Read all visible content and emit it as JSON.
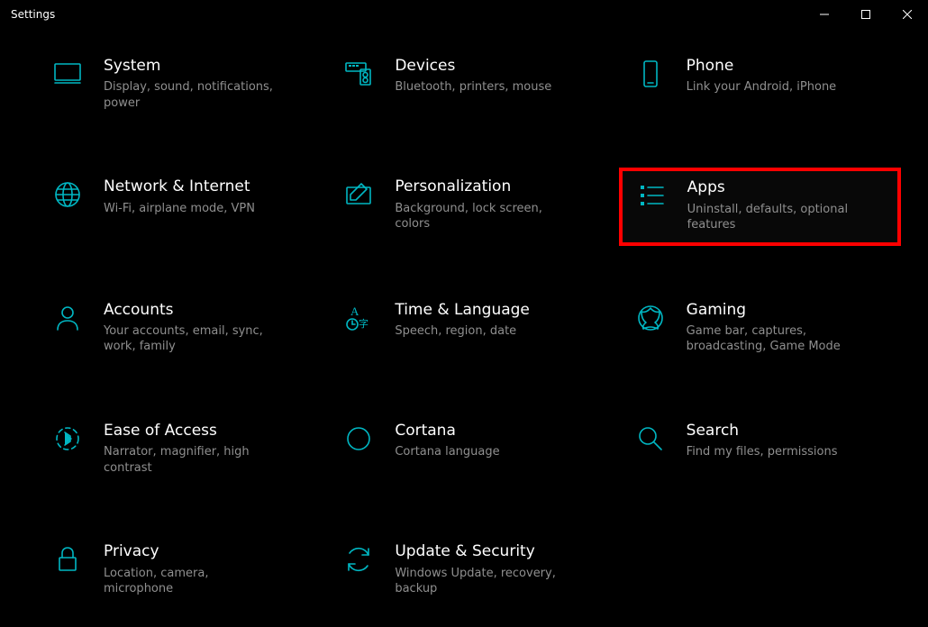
{
  "window": {
    "title": "Settings"
  },
  "accent": "#00b7c3",
  "categories": [
    {
      "id": "system",
      "title": "System",
      "desc": "Display, sound, notifications, power"
    },
    {
      "id": "devices",
      "title": "Devices",
      "desc": "Bluetooth, printers, mouse"
    },
    {
      "id": "phone",
      "title": "Phone",
      "desc": "Link your Android, iPhone"
    },
    {
      "id": "network",
      "title": "Network & Internet",
      "desc": "Wi-Fi, airplane mode, VPN"
    },
    {
      "id": "personalization",
      "title": "Personalization",
      "desc": "Background, lock screen, colors"
    },
    {
      "id": "apps",
      "title": "Apps",
      "desc": "Uninstall, defaults, optional features",
      "highlight": true
    },
    {
      "id": "accounts",
      "title": "Accounts",
      "desc": "Your accounts, email, sync, work, family"
    },
    {
      "id": "time",
      "title": "Time & Language",
      "desc": "Speech, region, date"
    },
    {
      "id": "gaming",
      "title": "Gaming",
      "desc": "Game bar, captures, broadcasting, Game Mode"
    },
    {
      "id": "ease",
      "title": "Ease of Access",
      "desc": "Narrator, magnifier, high contrast"
    },
    {
      "id": "cortana",
      "title": "Cortana",
      "desc": "Cortana language"
    },
    {
      "id": "search",
      "title": "Search",
      "desc": "Find my files, permissions"
    },
    {
      "id": "privacy",
      "title": "Privacy",
      "desc": "Location, camera, microphone"
    },
    {
      "id": "update",
      "title": "Update & Security",
      "desc": "Windows Update, recovery, backup"
    }
  ]
}
